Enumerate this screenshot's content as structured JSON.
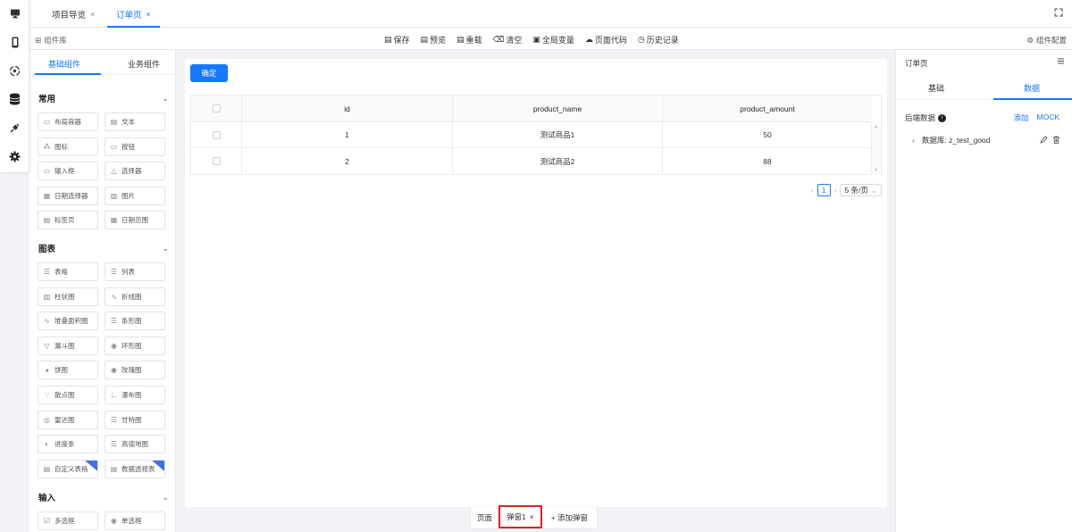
{
  "rail": {
    "items": [
      {
        "icon": "monitor-icon"
      },
      {
        "icon": "mobile-icon"
      },
      {
        "icon": "cycle-icon"
      },
      {
        "icon": "database-icon"
      },
      {
        "icon": "plug-icon"
      },
      {
        "icon": "gear-icon"
      }
    ]
  },
  "top_tabs": [
    {
      "label": "项目导览",
      "active": false
    },
    {
      "label": "订单页",
      "active": true
    }
  ],
  "toolbar": {
    "library_title": "组件库",
    "tools": [
      "保存",
      "预览",
      "重载",
      "清空",
      "全局变量",
      "页面代码",
      "历史记录"
    ],
    "component_config": "组件配置"
  },
  "left_panel": {
    "tabs": [
      "基础组件",
      "业务组件"
    ],
    "sections": [
      {
        "title": "常用",
        "items": [
          "布局容器",
          "文本",
          "图标",
          "按钮",
          "输入框",
          "选择器",
          "日期选择器",
          "图片",
          "标签页",
          "日期范围"
        ]
      },
      {
        "title": "图表",
        "items": [
          "表格",
          "列表",
          "柱状图",
          "折线图",
          "堆叠面积图",
          "条形图",
          "漏斗图",
          "环形图",
          "饼图",
          "玫瑰图",
          "散点图",
          "瀑布图",
          "雷达图",
          "甘特图",
          "进度条",
          "高德地图",
          "自定义表格",
          "数据透视表"
        ]
      },
      {
        "title": "输入",
        "items": [
          "多选框",
          "单选框"
        ]
      }
    ]
  },
  "canvas": {
    "confirm_label": "确定",
    "table": {
      "columns": [
        "id",
        "product_name",
        "product_amount"
      ],
      "rows": [
        [
          "1",
          "测试商品1",
          "50"
        ],
        [
          "2",
          "测试商品2",
          "88"
        ]
      ]
    },
    "pager": {
      "current": "1",
      "page_size": "5 条/页"
    }
  },
  "bottom_tabs": {
    "page": "页面",
    "popup": "弹窗1",
    "add": "+ 添加弹窗"
  },
  "right_panel": {
    "title": "订单页",
    "tabs": [
      "基础",
      "数据"
    ],
    "backend_label": "后端数据",
    "add_label": "添加",
    "mock_label": "MOCK",
    "db_label": "数据库: z_test_good"
  },
  "colors": {
    "accent": "#1677ff",
    "highlight_border": "#e02020"
  }
}
